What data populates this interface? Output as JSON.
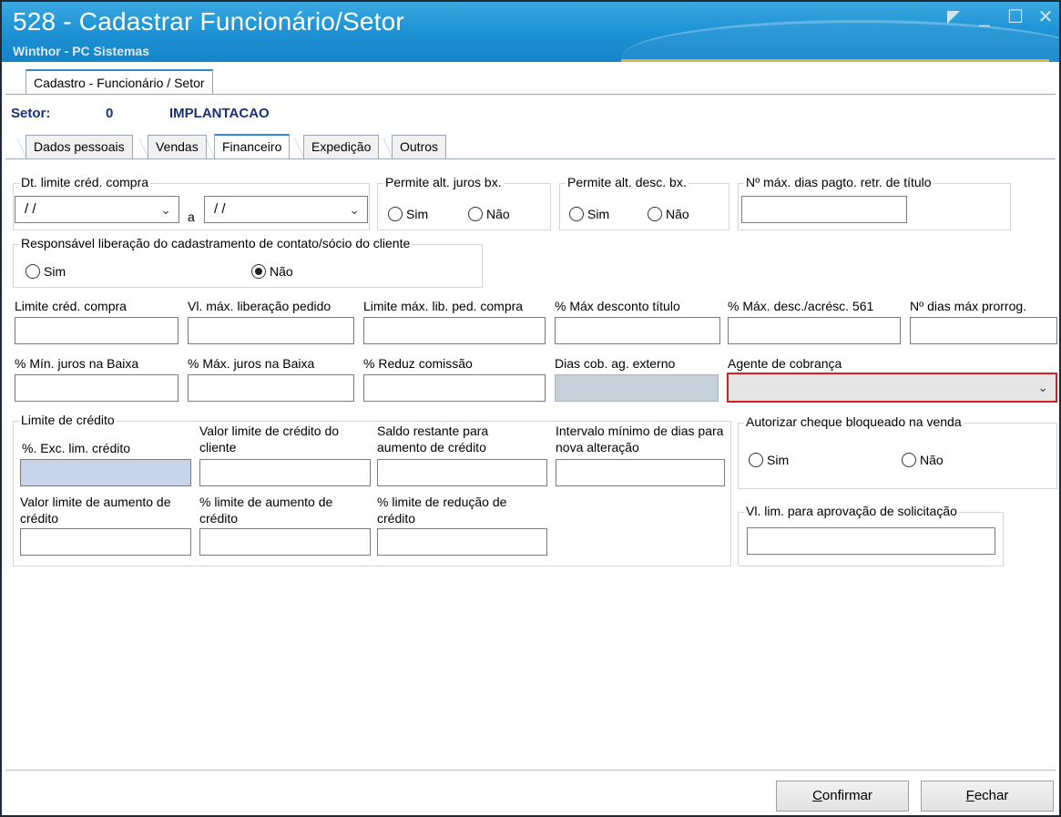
{
  "window": {
    "title": "528 - Cadastrar Funcionário/Setor",
    "subtitle": "Winthor - PC Sistemas",
    "controls": {
      "minimize": "_",
      "maximize": "☐",
      "close": "✕"
    }
  },
  "outer_tab": {
    "label": "Cadastro - Funcionário / Setor"
  },
  "setor": {
    "label": "Setor:",
    "code": "0",
    "name": "IMPLANTACAO"
  },
  "tabs": [
    {
      "label": "Dados pessoais"
    },
    {
      "label": "Vendas"
    },
    {
      "label": "Financeiro"
    },
    {
      "label": "Expedição"
    },
    {
      "label": "Outros"
    }
  ],
  "active_tab": "Financeiro",
  "financeiro": {
    "dt_limite": {
      "title": "Dt.  limite créd. compra",
      "from_value": "/ /",
      "sep": "a",
      "to_value": "/ /"
    },
    "permite_juros": {
      "title": "Permite alt. juros bx.",
      "sim": "Sim",
      "nao": "Não",
      "selected": ""
    },
    "permite_desc": {
      "title": "Permite alt. desc. bx.",
      "sim": "Sim",
      "nao": "Não",
      "selected": ""
    },
    "max_dias_pagto": {
      "title": "Nº máx. dias pagto. retr. de título",
      "value": ""
    },
    "responsavel": {
      "title": "Responsável liberação do cadastramento de contato/sócio do cliente",
      "sim": "Sim",
      "nao": "Não",
      "selected": "Não"
    },
    "row1": {
      "limite_cred_compra": "Limite créd. compra",
      "vl_max_lib_pedido": "Vl. máx. liberação pedido",
      "limite_max_lib_ped": "Limite máx. lib. ped. compra",
      "max_desc_titulo": "% Máx desconto título",
      "max_desc_acresc": "% Máx. desc./acrésc. 561",
      "dias_max_prorrog": "Nº dias máx prorrog."
    },
    "row2": {
      "min_juros_baixa": "% Mín. juros na Baixa",
      "max_juros_baixa": "% Máx. juros na Baixa",
      "reduz_comissao": "% Reduz  comissão",
      "dias_cob_ag_externo": "Dias cob. ag. externo",
      "agente_cobranca": "Agente de cobrança",
      "agente_cobranca_value": ""
    },
    "limite_credito": {
      "title": "Limite de crédito",
      "exc_lim_credito": "%. Exc. lim. crédito",
      "valor_limite_cliente": "Valor limite de crédito do cliente",
      "saldo_restante": "Saldo restante para aumento de crédito",
      "intervalo_minimo": "Intervalo mínimo de dias para nova alteração",
      "valor_limite_aumento": "Valor limite de aumento de crédito",
      "limite_aumento": "% limite de aumento de crédito",
      "limite_reducao": "% limite de redução de crédito"
    },
    "autorizar_cheque": {
      "title": "Autorizar cheque bloqueado na venda",
      "sim": "Sim",
      "nao": "Não",
      "selected": ""
    },
    "vl_lim_aprovacao": {
      "title": "Vl. lim. para aprovação de solicitação",
      "value": ""
    }
  },
  "buttons": {
    "confirmar_first": "C",
    "confirmar_rest": "onfirmar",
    "fechar_first": "F",
    "fechar_rest": "echar"
  },
  "colors": {
    "title_bar": "#1f94d6",
    "highlight_border": "#d21f1f",
    "setor_text": "#1a2f7a"
  }
}
